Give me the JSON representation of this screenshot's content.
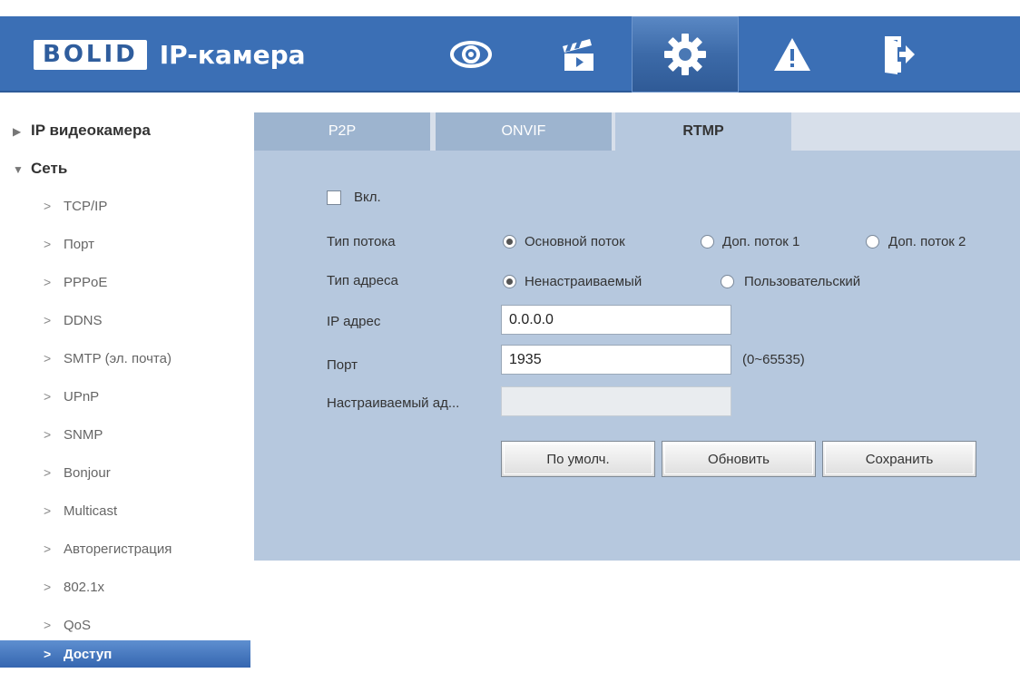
{
  "header": {
    "logo": "BOLID",
    "product": "IP-камера",
    "nav": [
      {
        "icon": "eye-icon"
      },
      {
        "icon": "clapperboard-icon"
      },
      {
        "icon": "gear-icon",
        "active": true
      },
      {
        "icon": "warning-icon"
      },
      {
        "icon": "logout-icon"
      }
    ]
  },
  "sidebar": {
    "groups": [
      {
        "label": "IP видеокамера",
        "expanded": false
      },
      {
        "label": "Сеть",
        "expanded": true
      }
    ],
    "items": [
      "TCP/IP",
      "Порт",
      "PPPoE",
      "DDNS",
      "SMTP (эл. почта)",
      "UPnP",
      "SNMP",
      "Bonjour",
      "Multicast",
      "Авторегистрация",
      "802.1x",
      "QoS",
      "Доступ"
    ],
    "active_item": "Доступ"
  },
  "tabs": [
    "P2P",
    "ONVIF",
    "RTMP"
  ],
  "active_tab": "RTMP",
  "form": {
    "enable_label": "Вкл.",
    "enabled": false,
    "stream_type_label": "Тип потока",
    "stream_options": [
      "Основной поток",
      "Доп. поток 1",
      "Доп. поток 2"
    ],
    "stream_selected": "Основной поток",
    "address_type_label": "Тип адреса",
    "address_options": [
      "Ненастраиваемый",
      "Пользовательский"
    ],
    "address_selected": "Ненастраиваемый",
    "ip_label": "IP адрес",
    "ip_value": "0.0.0.0",
    "port_label": "Порт",
    "port_value": "1935",
    "port_range": "(0~65535)",
    "custom_address_label": "Настраиваемый ад...",
    "custom_address_value": ""
  },
  "buttons": {
    "default": "По умолч.",
    "refresh": "Обновить",
    "save": "Сохранить"
  },
  "colors": {
    "header_bg": "#3b6fb5",
    "panel_bg": "#b6c8de",
    "tab_inactive": "#9db4cf",
    "active_item": "#4a7cc0"
  }
}
